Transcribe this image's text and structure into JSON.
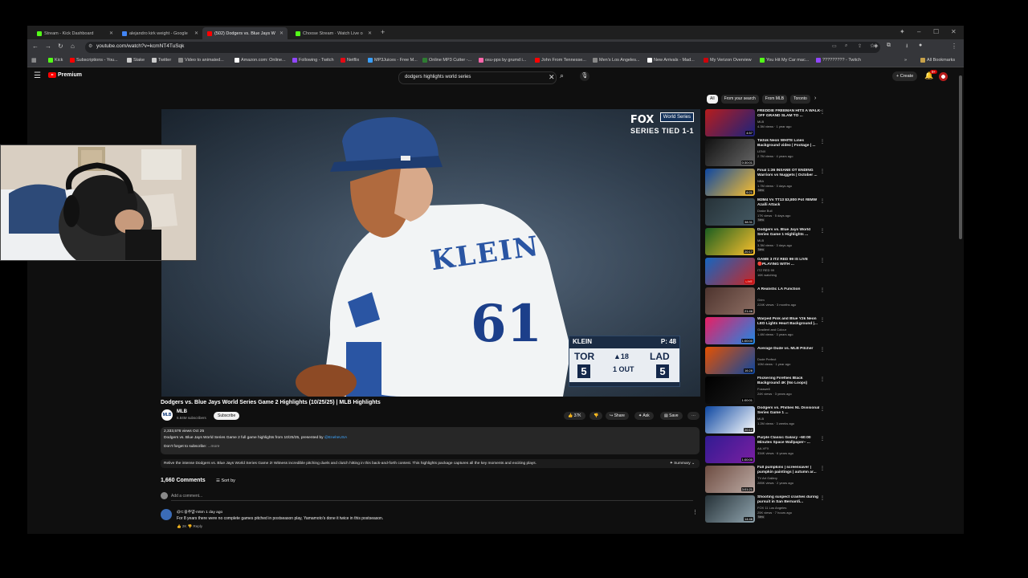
{
  "browser": {
    "tabs": [
      {
        "title": "Stream - Kick Dashboard",
        "color": "#53fc18"
      },
      {
        "title": "alejandro kirk weight - Google",
        "color": "#4285f4"
      },
      {
        "title": "(502) Dodgers vs. Blue Jays W",
        "color": "#ff0000"
      },
      {
        "title": "Choose Stream · Watch Live o",
        "color": "#53fc18"
      }
    ],
    "url": "youtube.com/watch?v=kcmNT4TuSqk",
    "bookmarks": [
      {
        "label": "Kick",
        "color": "#53fc18"
      },
      {
        "label": "Subscriptions - You...",
        "color": "#ff0000"
      },
      {
        "label": "Stake",
        "color": "#cccccc"
      },
      {
        "label": "Twitter",
        "color": "#cccccc"
      },
      {
        "label": "Video to animated...",
        "color": "#888888"
      },
      {
        "label": "Amazon.com: Online...",
        "color": "#ffffff"
      },
      {
        "label": "Following - Twitch",
        "color": "#9146ff"
      },
      {
        "label": "Netflix",
        "color": "#e50914"
      },
      {
        "label": "MP3Juices - Free M...",
        "color": "#3aa0ff"
      },
      {
        "label": "Online MP3 Cutter -...",
        "color": "#2e7d32"
      },
      {
        "label": "osu-pps by grumd i...",
        "color": "#ff66aa"
      },
      {
        "label": "John From Tennesse...",
        "color": "#ff0000"
      },
      {
        "label": "Men's Los Angeles...",
        "color": "#888888"
      },
      {
        "label": "New Arrivals - Mad...",
        "color": "#ffffff"
      },
      {
        "label": "My Verizon Overview",
        "color": "#cd040b"
      },
      {
        "label": "You Hit My Car mac...",
        "color": "#53fc18"
      },
      {
        "label": "????????? - Twitch",
        "color": "#9146ff"
      }
    ],
    "all_bookmarks": "All Bookmarks"
  },
  "youtube": {
    "logo_text": "Premium",
    "search_query": "dodgers highlights world series",
    "create_label": "Create",
    "notif_count": "9+"
  },
  "player": {
    "broadcaster": "FOX",
    "ws_logo": "World Series",
    "series_status": "SERIES TIED 1-1",
    "jersey_name": "KLEIN",
    "jersey_number": "61",
    "scorebug": {
      "pitcher": "KLEIN",
      "pitch_count": "P: 48",
      "away_team": "TOR",
      "away_runs": "5",
      "home_team": "LAD",
      "home_runs": "5",
      "inning": "▲18",
      "outs": "1 OUT"
    }
  },
  "video": {
    "title": "Dodgers vs. Blue Jays World Series Game 2 Highlights (10/25/25) | MLB Highlights",
    "channel": "MLB",
    "channel_subs": "6.84M subscribers",
    "subscribe_label": "Subscribe",
    "likes": "37K",
    "share_label": "Share",
    "ask_label": "Ask",
    "save_label": "Save",
    "views_date": "2,333,576 views  Oct 25",
    "desc_line": "Dodgers vs. Blue Jays World Series Game 2 full game highlights from 10/25/25, presented by",
    "desc_sponsor": "@EnelIeUSA",
    "desc_line2": "Don't forget to subscribe:",
    "desc_more": "...more",
    "ai_summary": "Relive the intense Dodgers vs. Blue Jays World Series Game 2! Witness incredible pitching duels and clutch hitting in this back-and-forth contest. This highlights package captures all the key moments and exciting plays.",
    "summary_label": "Summary"
  },
  "comments": {
    "count": "1,660 Comments",
    "sort_label": "Sort by",
    "add_placeholder": "Add a comment...",
    "items": [
      {
        "user": "@ㄷ용주얌-m5m  1 day ago",
        "text": "For 8 years there were no complete games pitched in postseason play, Yamamoto's done it twice in this postseason.",
        "likes": "2K",
        "reply": "Reply"
      }
    ]
  },
  "sidebar": {
    "chips": [
      "All",
      "From your search",
      "From MLB",
      "Toronto"
    ],
    "items": [
      {
        "title": "FREDDIE FREEMAN HITS A WALK-OFF GRAND SLAM TO ...",
        "channel": "MLB",
        "meta": "4.3M views · 1 year ago",
        "duration": "4:57",
        "new": "",
        "c1": "#b71c1c",
        "c2": "#1a237e"
      },
      {
        "title": "Tiktok Neon WHITE Lines Background video | Footage | ...",
        "channel": "LENX",
        "meta": "2.7M views · 4 years ago",
        "duration": "0:30:01",
        "new": "",
        "c1": "#111111",
        "c2": "#666666"
      },
      {
        "title": "Final 1:36 INSANE OT ENDING Warriors vs Nuggets | October ...",
        "channel": "NBA",
        "meta": "1.7M views · 3 days ago",
        "duration": "6:21",
        "new": "New",
        "c1": "#0d47a1",
        "c2": "#fbc02d"
      },
      {
        "title": "M3M4 Vs TT13 $3,800 Pot #BMW Azalli Attack",
        "channel": "Drake Bull",
        "meta": "17K views · 5 days ago",
        "duration": "38:31",
        "new": "New",
        "c1": "#263238",
        "c2": "#455a64"
      },
      {
        "title": "Dodgers vs. Blue Jays World Series Game 1 Highlights ...",
        "channel": "MLB",
        "meta": "3.3M views · 3 days ago",
        "duration": "20:17",
        "new": "New",
        "c1": "#1b5e20",
        "c2": "#fbc02d"
      },
      {
        "title": "GAME 3 ITZ RED 99 IS LIVE 🔴PLAYING WITH ...",
        "channel": "ITZ RED 99",
        "meta": "16K watching",
        "duration": "LIVE",
        "new": "",
        "c1": "#1565c0",
        "c2": "#c62828"
      },
      {
        "title": "A Realistic LA Function",
        "channel": "Grim",
        "meta": "224K views · 3 months ago",
        "duration": "21:46",
        "new": "",
        "c1": "#4e342e",
        "c2": "#8d6e63"
      },
      {
        "title": "Warped Pink and Blue Y2k Neon LED Lights Heart Background |...",
        "channel": "Gradient and Colour",
        "meta": "1.4M views · 3 years ago",
        "duration": "1:00:00",
        "new": "",
        "c1": "#e91e63",
        "c2": "#1e88e5"
      },
      {
        "title": "Average Dude vs. MLB Pitcher",
        "channel": "Dude Perfect",
        "meta": "10M views · 1 year ago",
        "duration": "16:28",
        "new": "",
        "c1": "#e65100",
        "c2": "#0d47a1"
      },
      {
        "title": "Flickering Fireflies Black Background 4K (No Loops)",
        "channel": "Fosswell",
        "meta": "24K views · 3 years ago",
        "duration": "1:00:01",
        "new": "",
        "c1": "#000000",
        "c2": "#1a1a1a"
      },
      {
        "title": "Dodgers vs. Phillies NL Divisional Series Game 1 ...",
        "channel": "MLB",
        "meta": "1.2M views · 3 weeks ago",
        "duration": "20:12",
        "new": "",
        "c1": "#0d47a1",
        "c2": "#ffffff"
      },
      {
        "title": "Purple Classic Galaxy ~60:00 Minutes Space Wallpaper~ ...",
        "channel": "AA-VFX",
        "meta": "334K views · 6 years ago",
        "duration": "1:00:00",
        "new": "",
        "c1": "#311b92",
        "c2": "#7b1fa2"
      },
      {
        "title": "Fall pumpkins | screensaver | pumpkin paintings | autumn ar...",
        "channel": "TV Art Gallery",
        "meta": "285K views · 2 years ago",
        "duration": "3:01:21",
        "new": "",
        "c1": "#6d4c41",
        "c2": "#bcaaa4"
      },
      {
        "title": "Shooting suspect crashes during pursuit in San Bernardi...",
        "channel": "FOX 11 Los Angeles",
        "meta": "25K views · 7 hours ago",
        "duration": "14:46",
        "new": "New",
        "c1": "#263238",
        "c2": "#90a4ae"
      }
    ]
  }
}
